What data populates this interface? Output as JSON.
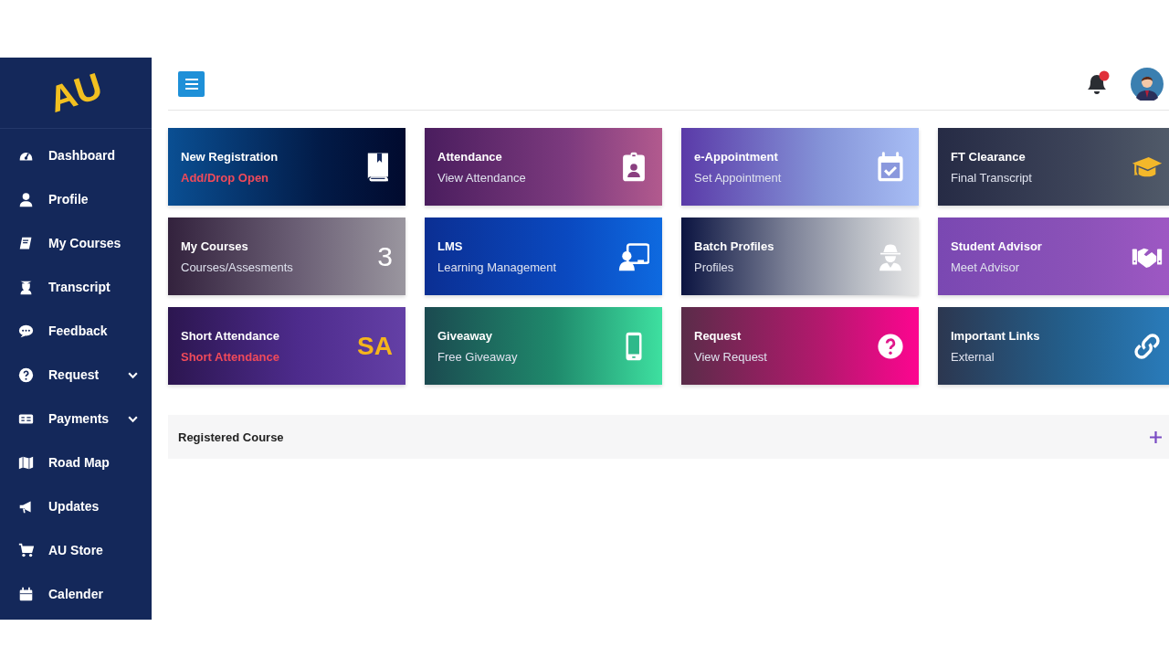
{
  "brand": {
    "logo": "AU"
  },
  "sidebar": {
    "items": [
      {
        "label": "Dashboard",
        "expandable": false
      },
      {
        "label": "Profile",
        "expandable": false
      },
      {
        "label": "My Courses",
        "expandable": false
      },
      {
        "label": "Transcript",
        "expandable": false
      },
      {
        "label": "Feedback",
        "expandable": false
      },
      {
        "label": "Request",
        "expandable": true
      },
      {
        "label": "Payments",
        "expandable": true
      },
      {
        "label": "Road Map",
        "expandable": false
      },
      {
        "label": "Updates",
        "expandable": false
      },
      {
        "label": "AU Store",
        "expandable": false
      },
      {
        "label": "Calender",
        "expandable": false
      }
    ]
  },
  "header": {
    "notifications_unread": true
  },
  "cards": [
    {
      "title": "New Registration",
      "subtitle": "Add/Drop Open",
      "alert": true,
      "kind": "icon"
    },
    {
      "title": "Attendance",
      "subtitle": "View Attendance",
      "alert": false,
      "kind": "icon"
    },
    {
      "title": "e-Appointment",
      "subtitle": "Set Appointment",
      "alert": false,
      "kind": "icon"
    },
    {
      "title": "FT Clearance",
      "subtitle": "Final Transcript",
      "alert": false,
      "kind": "icon"
    },
    {
      "title": "My Courses",
      "subtitle": "Courses/Assesments",
      "alert": false,
      "kind": "count",
      "value": "3"
    },
    {
      "title": "LMS",
      "subtitle": "Learning Management",
      "alert": false,
      "kind": "icon"
    },
    {
      "title": "Batch Profiles",
      "subtitle": "Profiles",
      "alert": false,
      "kind": "icon"
    },
    {
      "title": "Student Advisor",
      "subtitle": "Meet Advisor",
      "alert": false,
      "kind": "icon"
    },
    {
      "title": "Short Attendance",
      "subtitle": "Short Attendance",
      "alert": true,
      "kind": "badge",
      "value": "SA"
    },
    {
      "title": "Giveaway",
      "subtitle": "Free Giveaway",
      "alert": false,
      "kind": "icon"
    },
    {
      "title": "Request",
      "subtitle": "View Request",
      "alert": false,
      "kind": "icon"
    },
    {
      "title": "Important Links",
      "subtitle": "External",
      "alert": false,
      "kind": "icon"
    }
  ],
  "panel": {
    "title": "Registered Course",
    "expanded": false
  }
}
